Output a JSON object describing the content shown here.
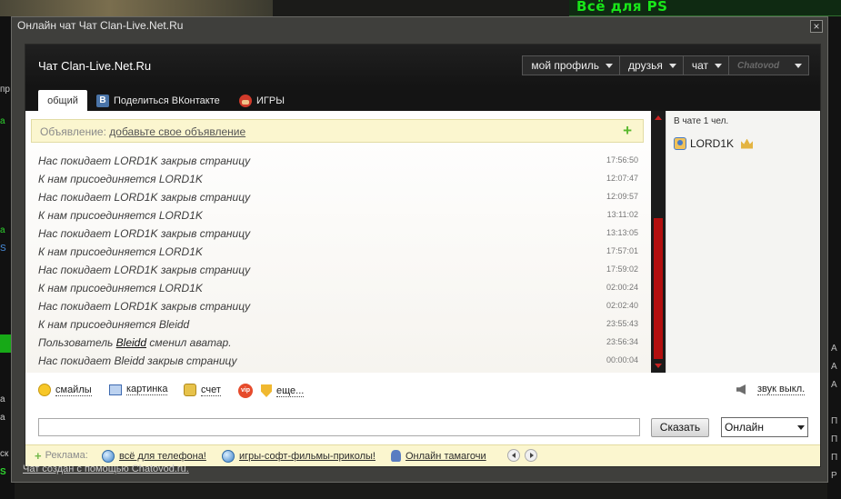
{
  "window": {
    "title": "Онлайн чат Чат Clan-Live.Net.Ru",
    "close_icon": "×",
    "footer_link": "Чат создан с помощью Chatovod.ru."
  },
  "background": {
    "top_right_text": "Всё для PS",
    "left_fragments": [
      "пр",
      "а",
      "а",
      "S",
      "а",
      "а",
      "ск",
      "S"
    ],
    "right_fragments": [
      "А",
      "А",
      "А",
      "П",
      "П",
      "П",
      "Р"
    ]
  },
  "header": {
    "title": "Чат Clan-Live.Net.Ru",
    "nav": [
      {
        "label": "мой профиль"
      },
      {
        "label": "друзья"
      },
      {
        "label": "чат"
      }
    ],
    "brand": "Chatovod"
  },
  "tabs": [
    {
      "label": "общий",
      "active": true
    },
    {
      "label": "Поделиться ВКонтакте",
      "icon": "vk-icon",
      "icon_text": "B"
    },
    {
      "label": "ИГРЫ",
      "icon": "mario-icon"
    }
  ],
  "announcement": {
    "prefix": "Объявление:",
    "link": "добавьте свое объявление",
    "plus": "+"
  },
  "messages": [
    {
      "text": "Нас покидает LORD1K закрыв страницу",
      "time": "17:56:50"
    },
    {
      "text": "К нам присоединяется LORD1K",
      "time": "12:07:47"
    },
    {
      "text": "Нас покидает LORD1K закрыв страницу",
      "time": "12:09:57"
    },
    {
      "text": "К нам присоединяется LORD1K",
      "time": "13:11:02"
    },
    {
      "text": "Нас покидает LORD1K закрыв страницу",
      "time": "13:13:05"
    },
    {
      "text": "К нам присоединяется LORD1K",
      "time": "17:57:01"
    },
    {
      "text": "Нас покидает LORD1K закрыв страницу",
      "time": "17:59:02"
    },
    {
      "text": "К нам присоединяется LORD1K",
      "time": "02:00:24"
    },
    {
      "text": "Нас покидает LORD1K закрыв страницу",
      "time": "02:02:40"
    },
    {
      "text": "К нам присоединяется Bleidd",
      "time": "23:55:43"
    },
    {
      "text_before": "Пользователь",
      "nick": "Bleidd",
      "text_after": "сменил аватар.",
      "time": "23:56:34"
    },
    {
      "text": "Нас покидает Bleidd закрыв страницу",
      "time": "00:00:04"
    }
  ],
  "users": {
    "count_label": "В чате 1 чел.",
    "list": [
      {
        "name": "LORD1K"
      }
    ]
  },
  "toolbar": {
    "smiles": "смайлы",
    "picture": "картинка",
    "score": "счет",
    "vip_icon_text": "vip",
    "more": "еще...",
    "sound": "звук выкл."
  },
  "input": {
    "value": "",
    "send_label": "Сказать",
    "status": "Онлайн"
  },
  "ads": {
    "label": "Реклама:",
    "items": [
      {
        "label": "всё для телефона!"
      },
      {
        "label": "игры-софт-фильмы-приколы!"
      },
      {
        "label": "Онлайн тамагочи"
      }
    ]
  },
  "colors": {
    "scroll_accent": "#b30f0f",
    "announce_bg": "#fbf6cf",
    "header_bg": "#141414"
  }
}
